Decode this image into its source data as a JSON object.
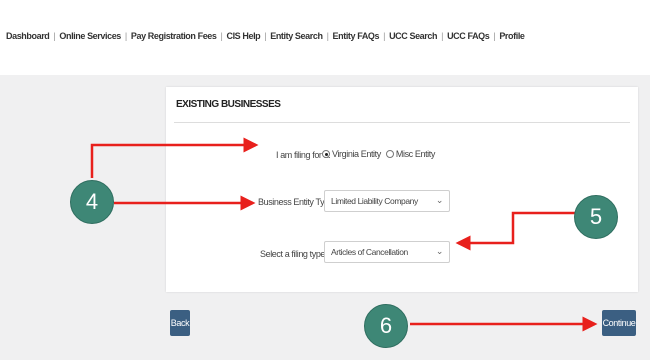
{
  "nav": {
    "items": [
      "Dashboard",
      "Online Services",
      "Pay Registration Fees",
      "CIS Help",
      "Entity Search",
      "Entity FAQs",
      "UCC Search",
      "UCC FAQs",
      "Profile"
    ]
  },
  "form": {
    "title": "EXISTING BUSINESSES",
    "filing_for_label": "I am filing for a:",
    "filing_for_options": [
      "Virginia Entity",
      "Misc Entity"
    ],
    "filing_for_selected": "Virginia Entity",
    "entity_type_label": "Business Entity Type:",
    "entity_type_value": "Limited Liability Company",
    "filing_type_label": "Select a filing type:",
    "filing_type_value": "Articles of Cancellation",
    "required_marker": "*",
    "dropdown_icon": "chevron-down-icon"
  },
  "buttons": {
    "back": "Back",
    "continue": "Continue"
  },
  "callouts": {
    "four": "4",
    "five": "5",
    "six": "6",
    "color": "#3e8776"
  },
  "colors": {
    "arrow": "#e8201c",
    "button": "#3b5f82"
  }
}
